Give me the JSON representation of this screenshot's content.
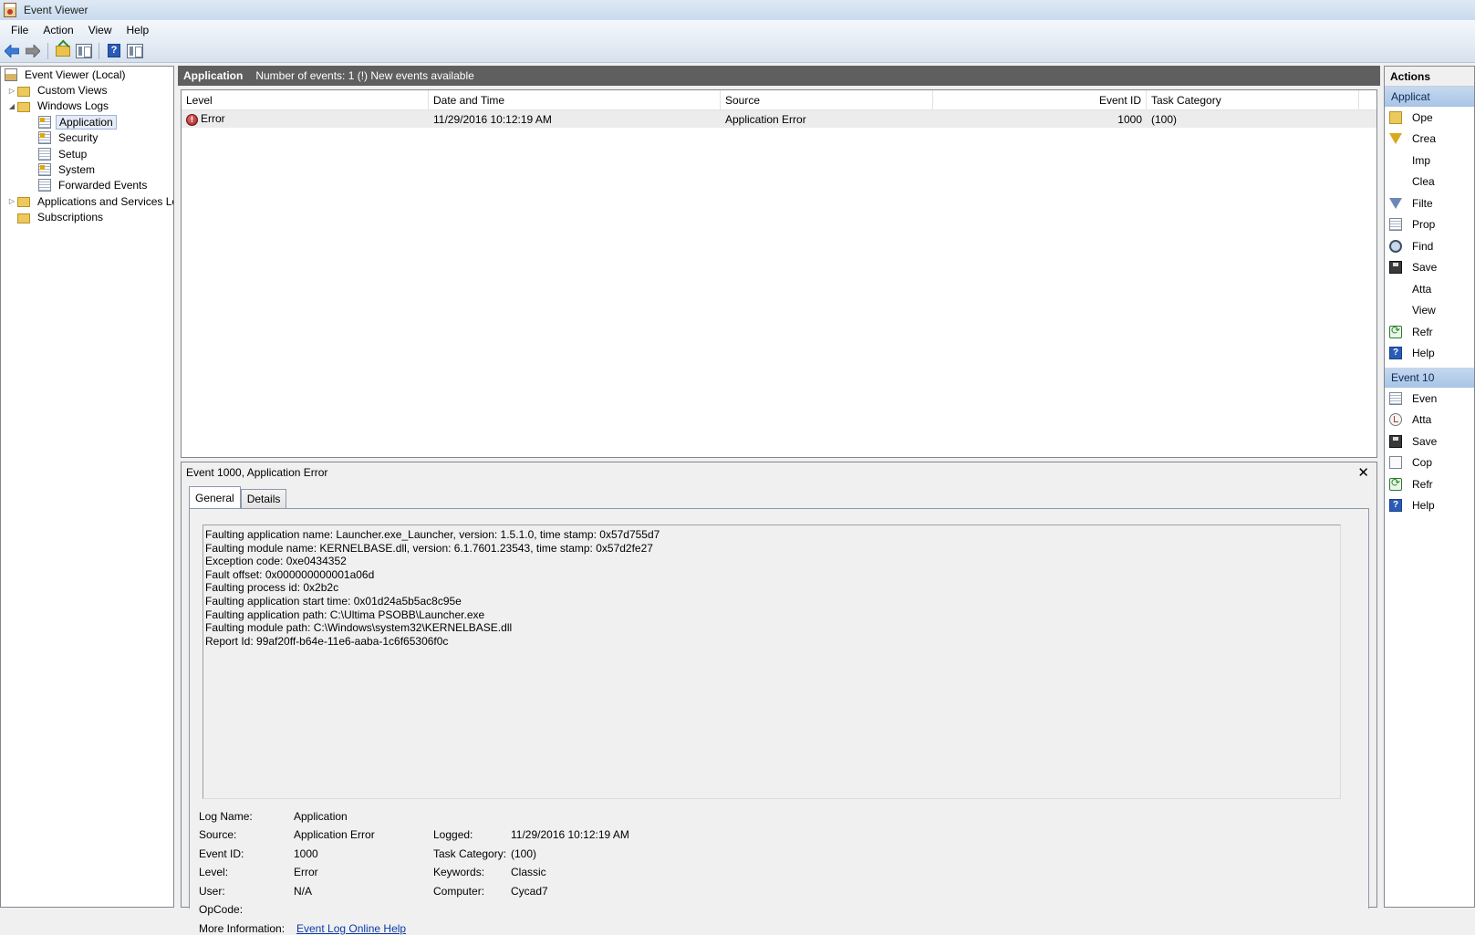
{
  "window": {
    "title": "Event Viewer"
  },
  "menu": [
    "File",
    "Action",
    "View",
    "Help"
  ],
  "toolbar": {
    "buttons": [
      "back-arrow-icon",
      "forward-arrow-icon",
      "folder-up-icon",
      "show-hide-console-tree-icon",
      "help-icon",
      "show-hide-action-pane-icon"
    ]
  },
  "tree": {
    "root": "Event Viewer (Local)",
    "custom_views": "Custom Views",
    "windows_logs": "Windows Logs",
    "application": "Application",
    "security": "Security",
    "setup": "Setup",
    "system": "System",
    "forwarded_events": "Forwarded Events",
    "apps_services": "Applications and Services Lo",
    "subscriptions": "Subscriptions"
  },
  "list_pane": {
    "title": "Application",
    "summary": "Number of events: 1 (!) New events available",
    "columns": {
      "level": "Level",
      "date": "Date and Time",
      "source": "Source",
      "event_id": "Event ID",
      "task": "Task Category"
    },
    "rows": [
      {
        "level": "Error",
        "date": "11/29/2016 10:12:19 AM",
        "source": "Application Error",
        "event_id": "1000",
        "task": "(100)"
      }
    ]
  },
  "detail": {
    "title": "Event 1000, Application Error",
    "close_glyph": "✕",
    "tabs": {
      "general": "General",
      "details": "Details"
    },
    "description_lines": [
      "Faulting application name: Launcher.exe_Launcher, version: 1.5.1.0, time stamp: 0x57d755d7",
      "Faulting module name: KERNELBASE.dll, version: 6.1.7601.23543, time stamp: 0x57d2fe27",
      "Exception code: 0xe0434352",
      "Fault offset: 0x000000000001a06d",
      "Faulting process id: 0x2b2c",
      "Faulting application start time: 0x01d24a5b5ac8c95e",
      "Faulting application path: C:\\Ultima PSOBB\\Launcher.exe",
      "Faulting module path: C:\\Windows\\system32\\KERNELBASE.dll",
      "Report Id: 99af20ff-b64e-11e6-aaba-1c6f65306f0c"
    ],
    "props": {
      "log_name_label": "Log Name:",
      "log_name": "Application",
      "source_label": "Source:",
      "source": "Application Error",
      "logged_label": "Logged:",
      "logged": "11/29/2016 10:12:19 AM",
      "event_id_label": "Event ID:",
      "event_id": "1000",
      "task_label": "Task Category:",
      "task": "(100)",
      "level_label": "Level:",
      "level": "Error",
      "keywords_label": "Keywords:",
      "keywords": "Classic",
      "user_label": "User:",
      "user": "N/A",
      "computer_label": "Computer:",
      "computer": "Cycad7",
      "opcode_label": "OpCode:",
      "opcode": "",
      "more_info_label": "More Information:",
      "more_info_link": "Event Log Online Help"
    }
  },
  "actions": {
    "title": "Actions",
    "section1": "Applicat",
    "items1": [
      "Ope",
      "Crea",
      "Imp",
      "Clea",
      "Filte",
      "Prop",
      "Find",
      "Save",
      "Atta",
      "View",
      "Refr",
      "Help"
    ],
    "section2": "Event 10",
    "items2": [
      "Even",
      "Atta",
      "Save",
      "Cop",
      "Refr",
      "Help"
    ]
  }
}
